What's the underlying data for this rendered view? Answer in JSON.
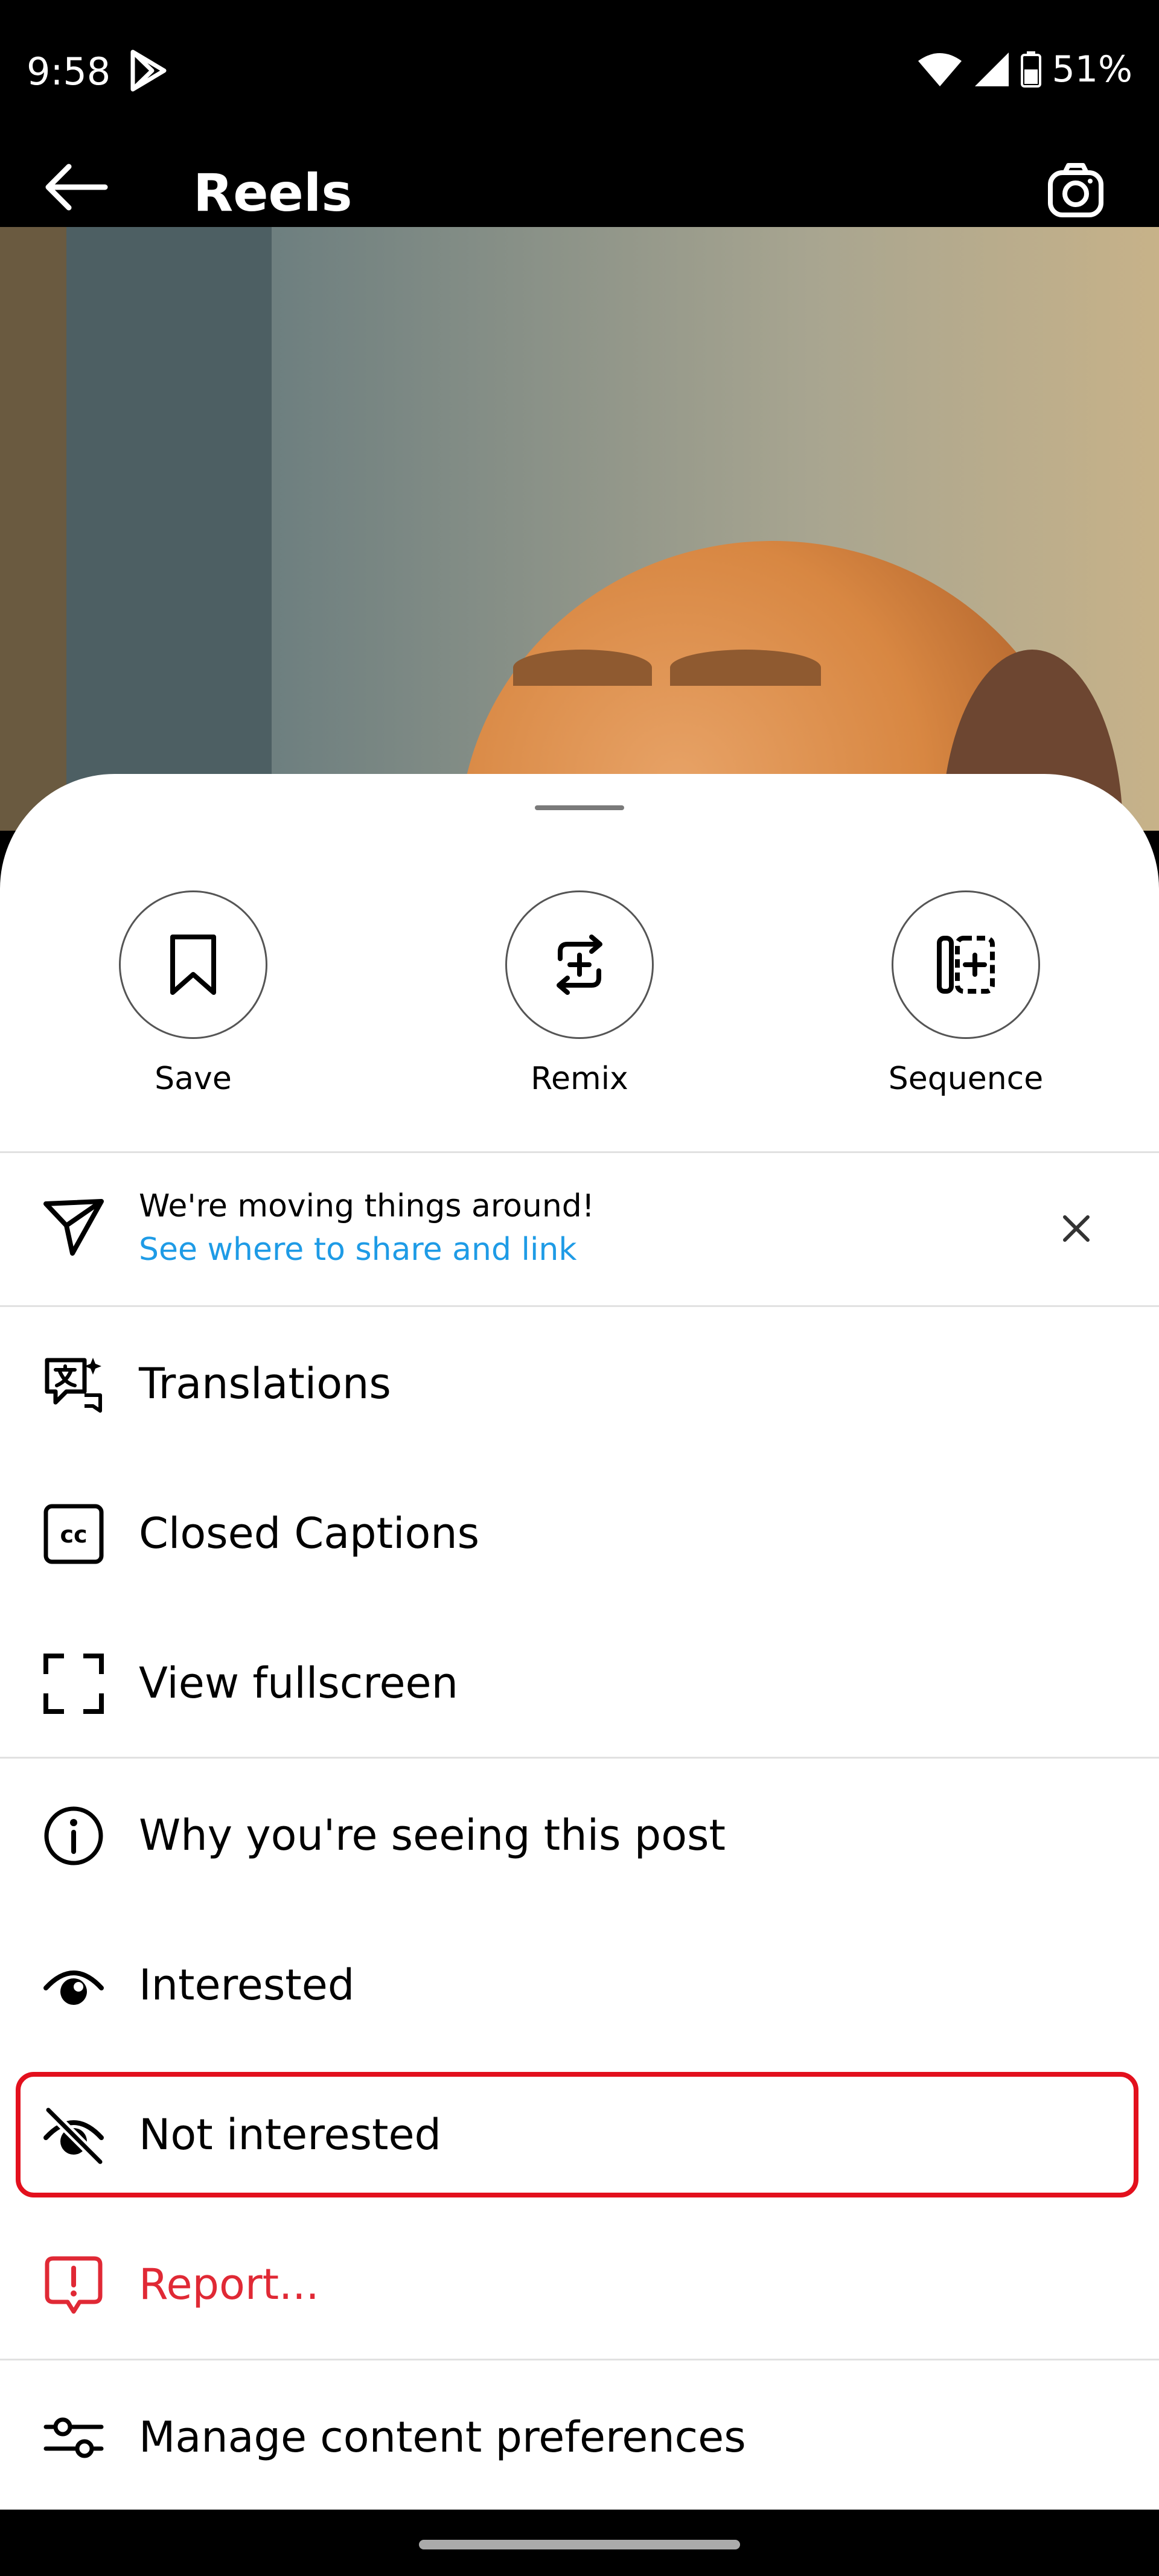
{
  "status_bar": {
    "time": "9:58",
    "battery": "51%"
  },
  "header": {
    "title": "Reels"
  },
  "actions": [
    {
      "label": "Save",
      "icon": "bookmark-icon"
    },
    {
      "label": "Remix",
      "icon": "remix-icon"
    },
    {
      "label": "Sequence",
      "icon": "sequence-icon"
    }
  ],
  "notice": {
    "title": "We're moving things around!",
    "link": "See where to share and link"
  },
  "menu": {
    "translations": "Translations",
    "closed_captions": "Closed Captions",
    "view_fullscreen": "View fullscreen",
    "why_seeing": "Why you're seeing this post",
    "interested": "Interested",
    "not_interested": "Not interested",
    "report": "Report...",
    "manage_preferences": "Manage content preferences"
  },
  "colors": {
    "link": "#1e9be6",
    "danger": "#e02935",
    "highlight": "#e3101d"
  }
}
